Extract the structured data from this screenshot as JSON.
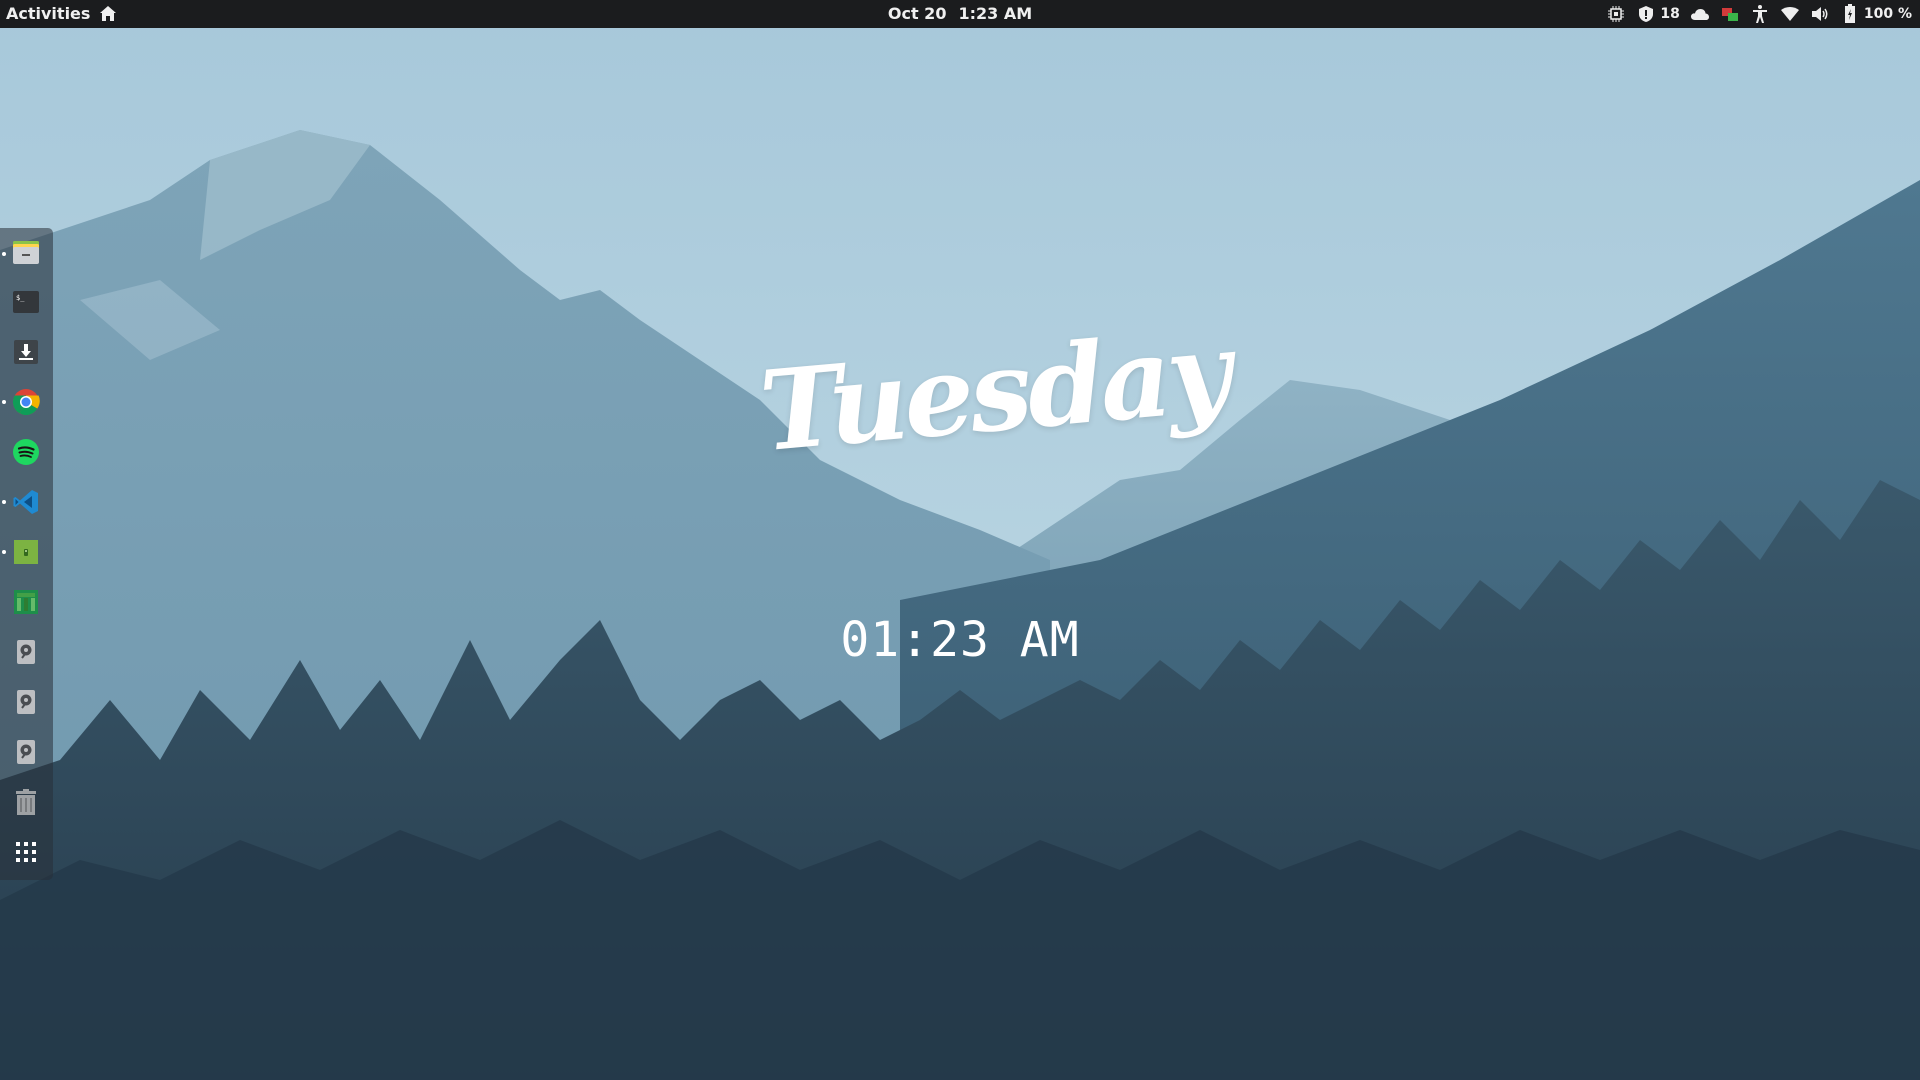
{
  "topbar": {
    "activities_label": "Activities",
    "home_icon": "home-icon",
    "date": "Oct 20",
    "time": "1:23 AM",
    "tray": {
      "notification_count": "18",
      "battery_label": "100 %",
      "icons": [
        "cpu-monitor-icon",
        "security-icon",
        "cloud-icon",
        "network-transfer-icon",
        "accessibility-icon",
        "wifi-icon",
        "volume-icon",
        "battery-icon"
      ]
    }
  },
  "dock": {
    "items": [
      {
        "name": "files",
        "icon": "file-manager-icon",
        "running": true
      },
      {
        "name": "terminal",
        "icon": "terminal-icon",
        "running": false
      },
      {
        "name": "downloads",
        "icon": "download-icon",
        "running": false
      },
      {
        "name": "chrome",
        "icon": "chrome-icon",
        "running": true
      },
      {
        "name": "spotify",
        "icon": "spotify-icon",
        "running": false
      },
      {
        "name": "vscode",
        "icon": "vscode-icon",
        "running": true
      },
      {
        "name": "android-studio",
        "icon": "android-icon",
        "running": true
      },
      {
        "name": "office-sheet",
        "icon": "spreadsheet-icon",
        "running": false
      },
      {
        "name": "drive-1",
        "icon": "disk-drive-icon",
        "running": false
      },
      {
        "name": "drive-2",
        "icon": "disk-drive-icon",
        "running": false
      },
      {
        "name": "drive-3",
        "icon": "disk-drive-icon",
        "running": false
      },
      {
        "name": "trash",
        "icon": "trash-icon",
        "running": false
      },
      {
        "name": "show-apps",
        "icon": "app-grid-icon",
        "running": false
      }
    ]
  },
  "widget": {
    "day": "Tuesday",
    "time": "01:23 AM"
  },
  "colors": {
    "topbar_bg": "#1b1c1e",
    "sky": "#a9cadb",
    "forest": "#2b4254",
    "dock_bg": "rgba(40,48,56,0.55)"
  }
}
